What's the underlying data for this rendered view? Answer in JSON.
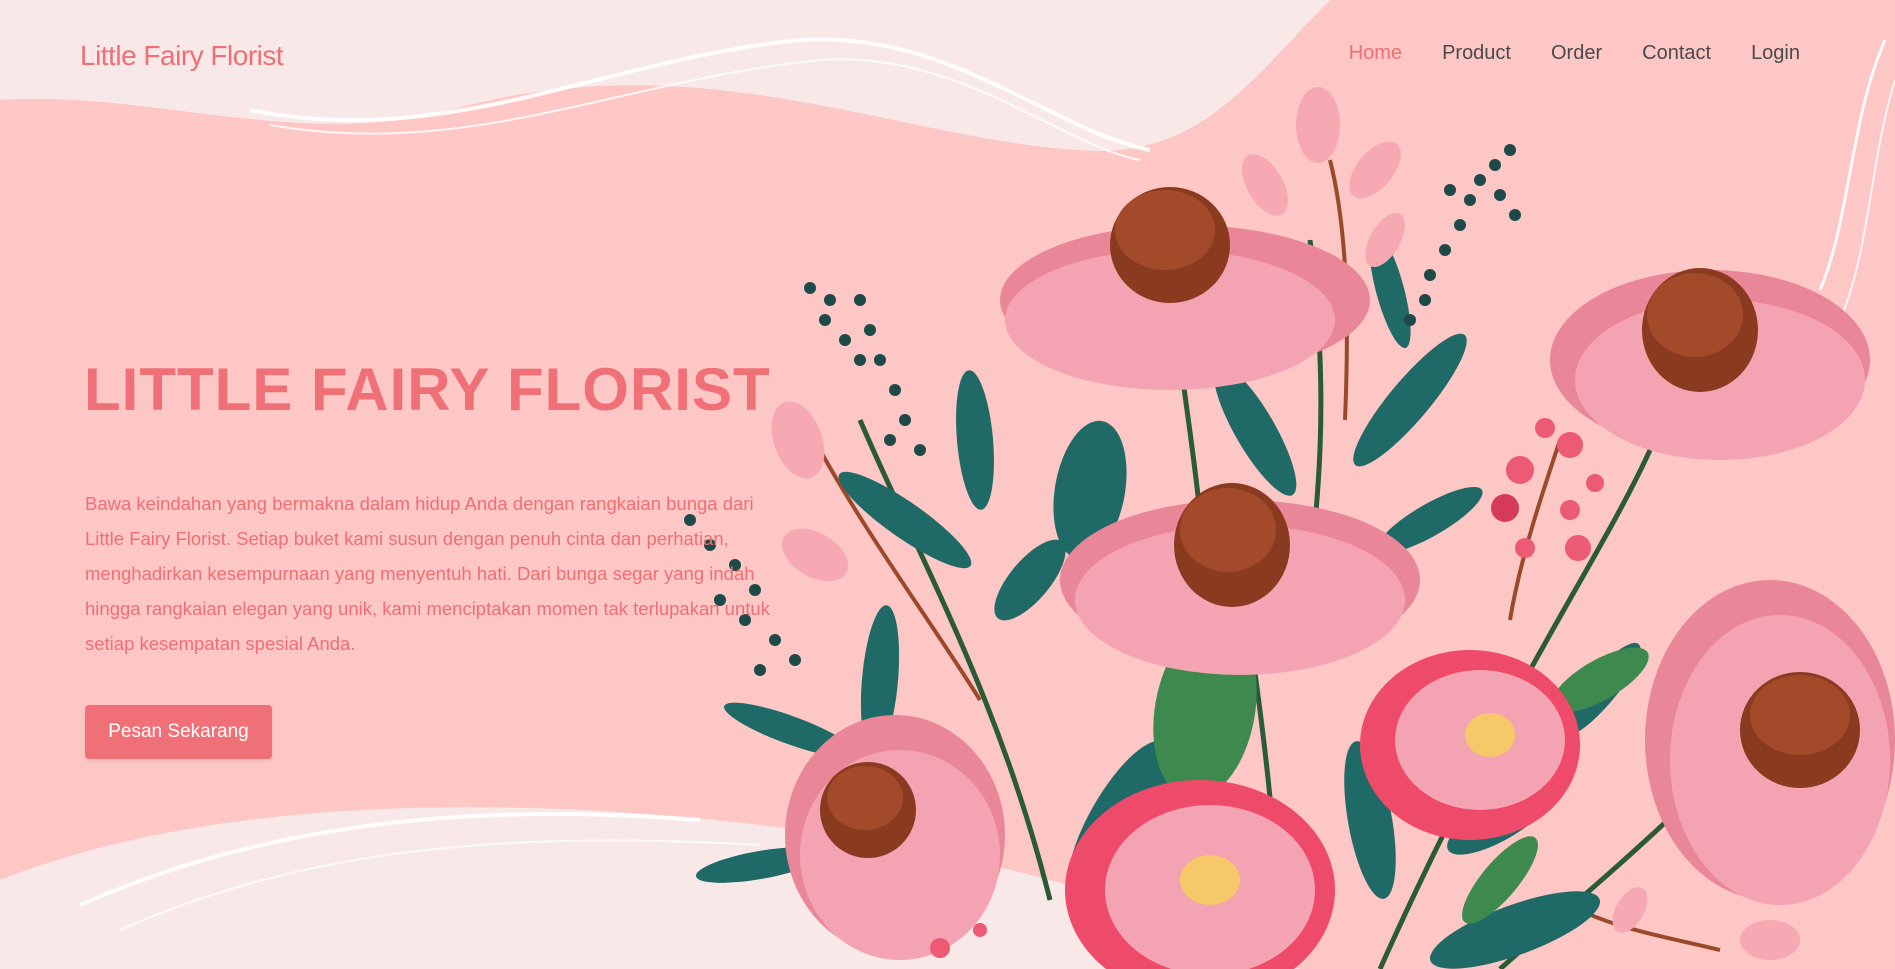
{
  "brand": {
    "name": "Little Fairy Florist"
  },
  "nav": {
    "items": [
      {
        "label": "Home",
        "active": true
      },
      {
        "label": "Product",
        "active": false
      },
      {
        "label": "Order",
        "active": false
      },
      {
        "label": "Contact",
        "active": false
      },
      {
        "label": "Login",
        "active": false
      }
    ]
  },
  "hero": {
    "title": "LITTLE FAIRY FLORIST",
    "description": "Bawa keindahan yang bermakna dalam hidup Anda dengan rangkaian bunga dari Little Fairy Florist. Setiap buket kami susun dengan penuh cinta dan perhatian, menghadirkan kesempurnaan yang menyentuh hati. Dari bunga segar yang indah hingga rangkaian elegan yang unik, kami menciptakan momen tak terlupakan untuk setiap kesempatan spesial Anda.",
    "cta_label": "Pesan Sekarang"
  },
  "colors": {
    "accent": "#f07077",
    "blob": "#fdc7c5",
    "background": "#f8e9e8",
    "petal_pink": "#f4a3b2",
    "petal_red": "#ee4b6a",
    "leaf_teal": "#1f6a67",
    "center_brown": "#8a3a1f"
  },
  "illustration": {
    "name": "flower-bouquet-illustration"
  }
}
